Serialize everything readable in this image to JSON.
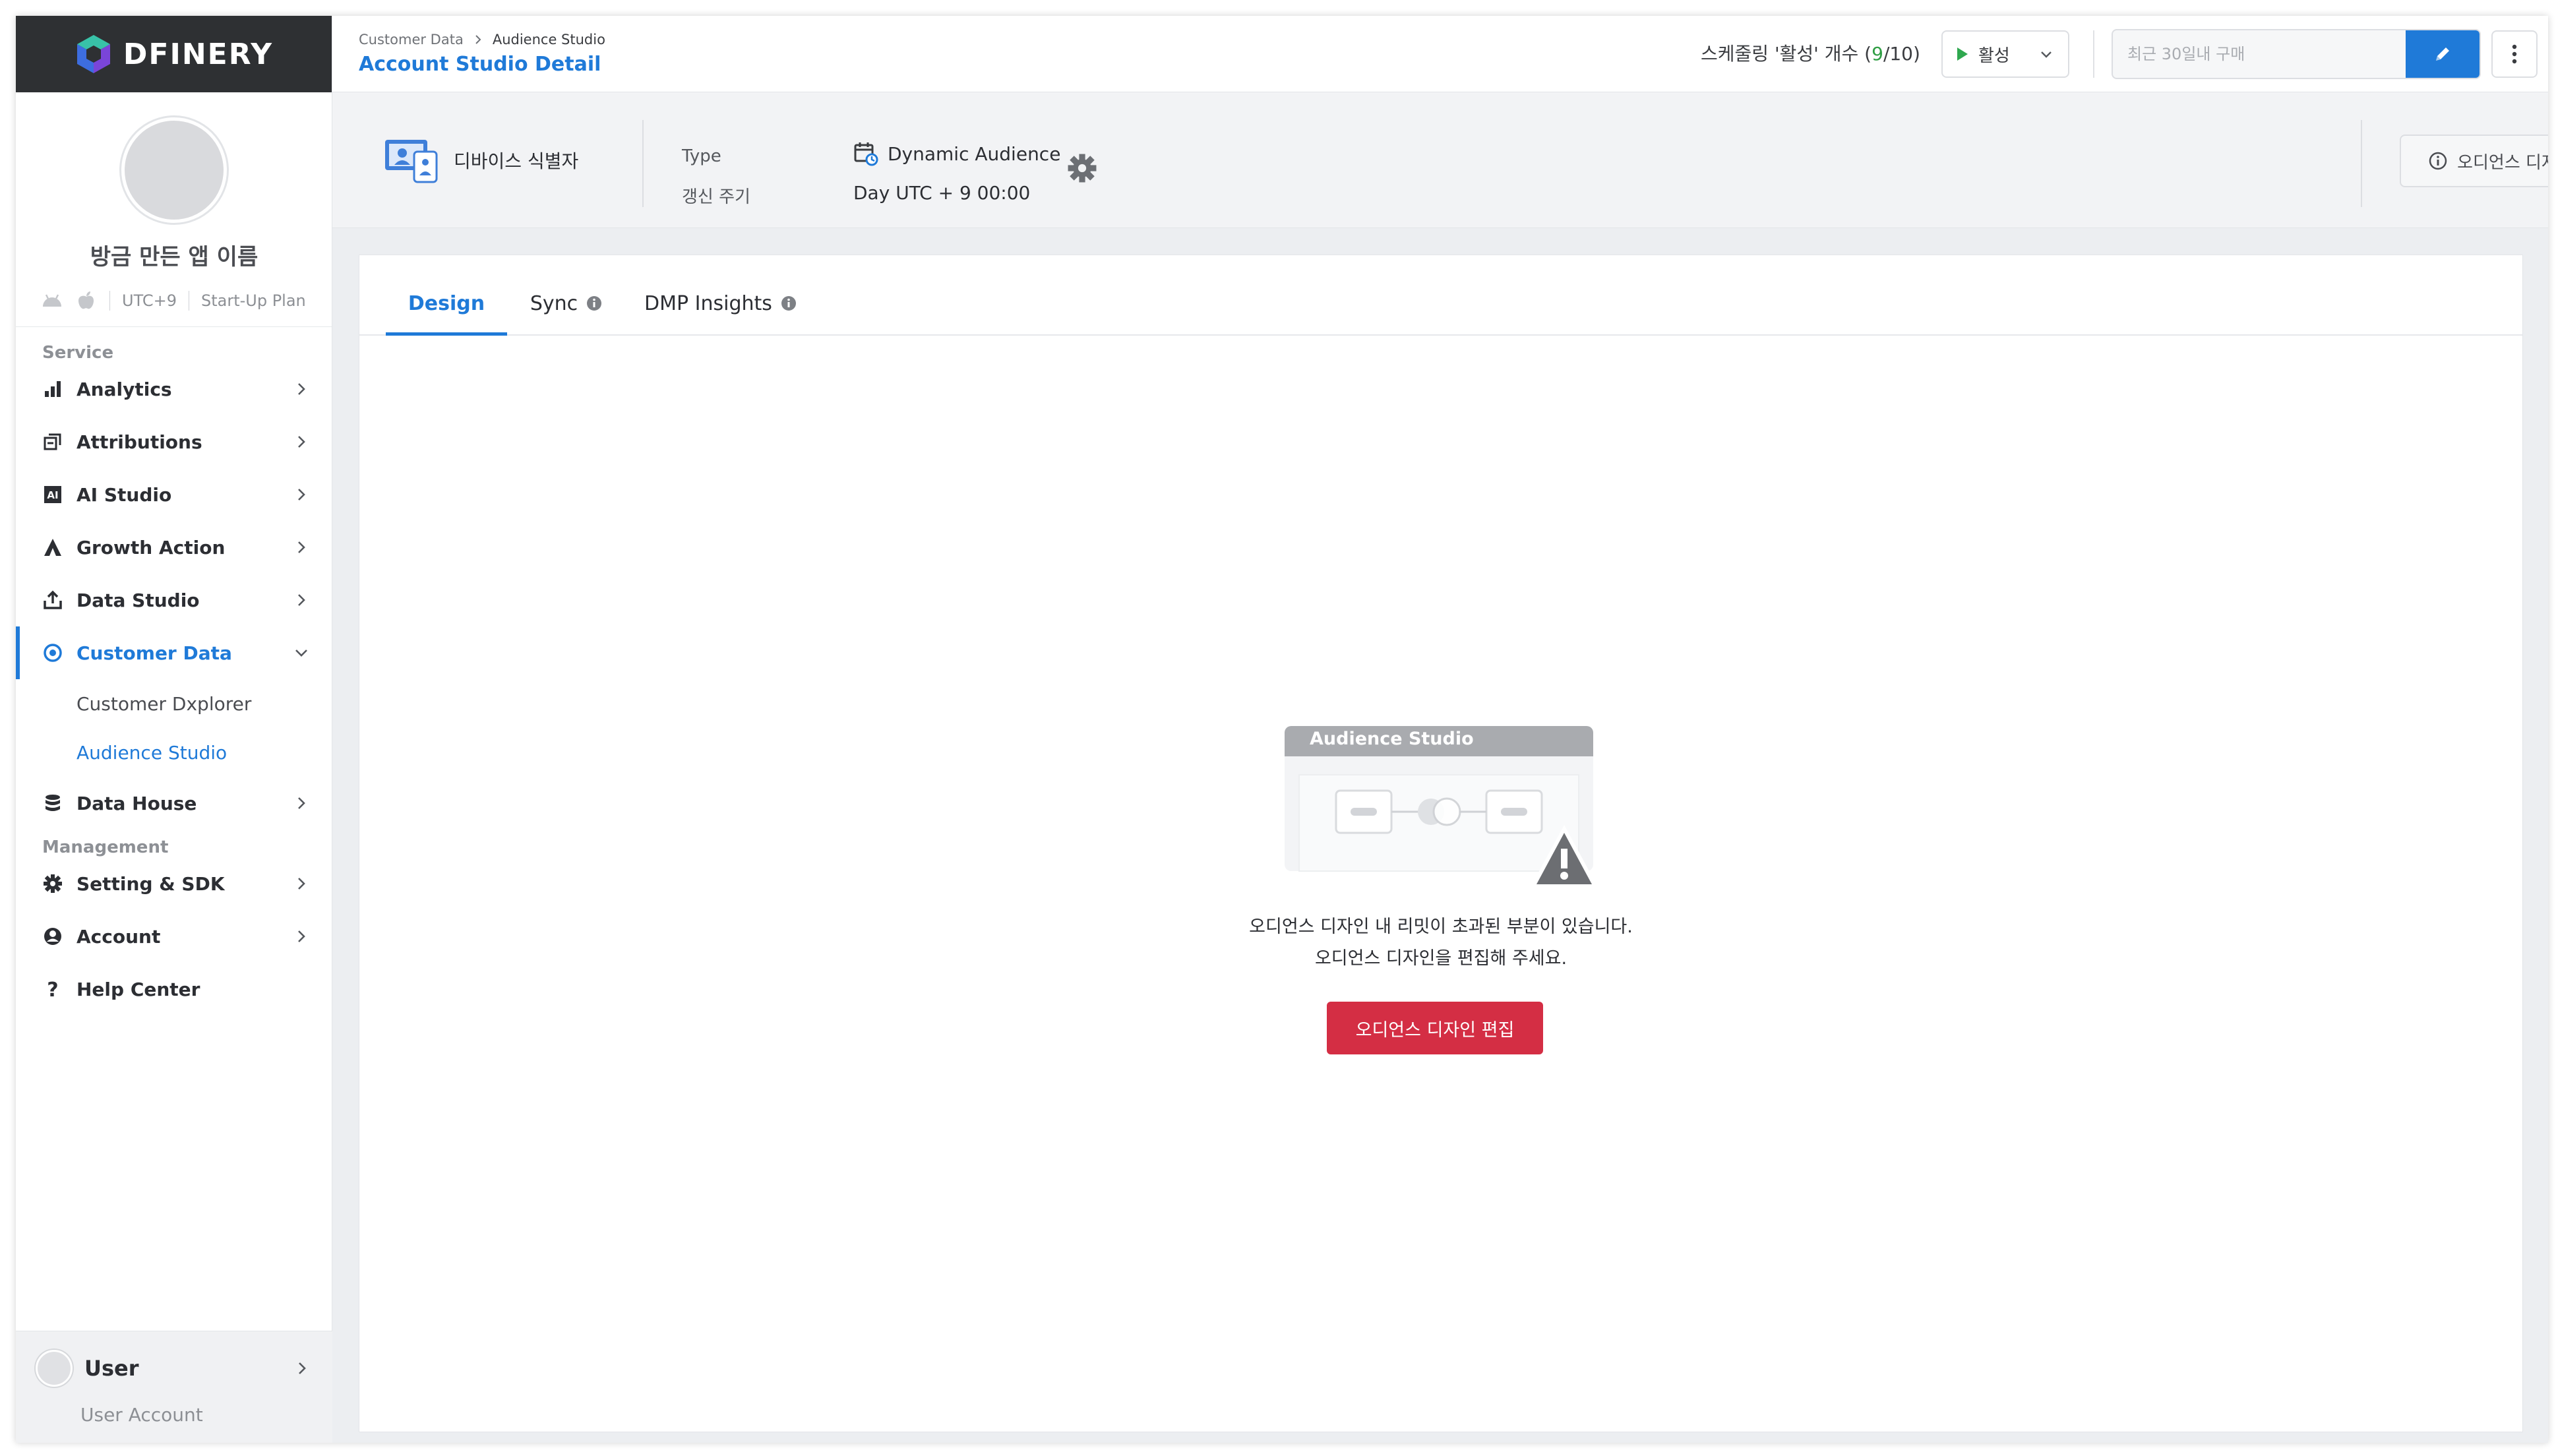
{
  "brand": {
    "logo_text": "DFINERY"
  },
  "profile": {
    "app_name": "방금 만든 앱 이름",
    "timezone": "UTC+9",
    "plan": "Start-Up Plan"
  },
  "sidebar": {
    "service_label": "Service",
    "management_label": "Management",
    "items": [
      {
        "label": "Analytics"
      },
      {
        "label": "Attributions"
      },
      {
        "label": "AI Studio"
      },
      {
        "label": "Growth Action"
      },
      {
        "label": "Data Studio"
      },
      {
        "label": "Customer Data"
      },
      {
        "label": "Data House"
      },
      {
        "label": "Setting & SDK"
      },
      {
        "label": "Account"
      },
      {
        "label": "Help Center"
      }
    ],
    "subitems": [
      {
        "label": "Customer Dxplorer"
      },
      {
        "label": "Audience Studio"
      }
    ],
    "user": {
      "name": "User",
      "sub": "User Account"
    }
  },
  "header": {
    "breadcrumb": [
      "Customer Data",
      "Audience Studio"
    ],
    "title": "Account Studio Detail",
    "schedule_prefix": "스케줄링 '활성' 개수 (",
    "schedule_active": "9",
    "schedule_suffix": "/10)",
    "status_value": "활성",
    "search_placeholder": "최근 30일내 구매"
  },
  "info": {
    "identifier": "디바이스 식별자",
    "type_label": "Type",
    "type_value": "Dynamic Audience",
    "cycle_label": "갱신 주기",
    "cycle_value": "Day UTC + 9 00:00",
    "notice": "오디언스 디자인이 완료되지 않은 상태입니다."
  },
  "tabs": [
    {
      "label": "Design"
    },
    {
      "label": "Sync"
    },
    {
      "label": "DMP Insights"
    }
  ],
  "empty": {
    "illustration_title": "Audience Studio",
    "line1": "오디언스 디자인 내 리밋이 초과된 부분이 있습니다.",
    "line2": "오디언스 디자인을 편집해 주세요.",
    "button": "오디언스 디자인 편집"
  },
  "colors": {
    "accent": "#1f7ad8",
    "danger": "#d42e44",
    "active_green": "#2f9e44"
  }
}
